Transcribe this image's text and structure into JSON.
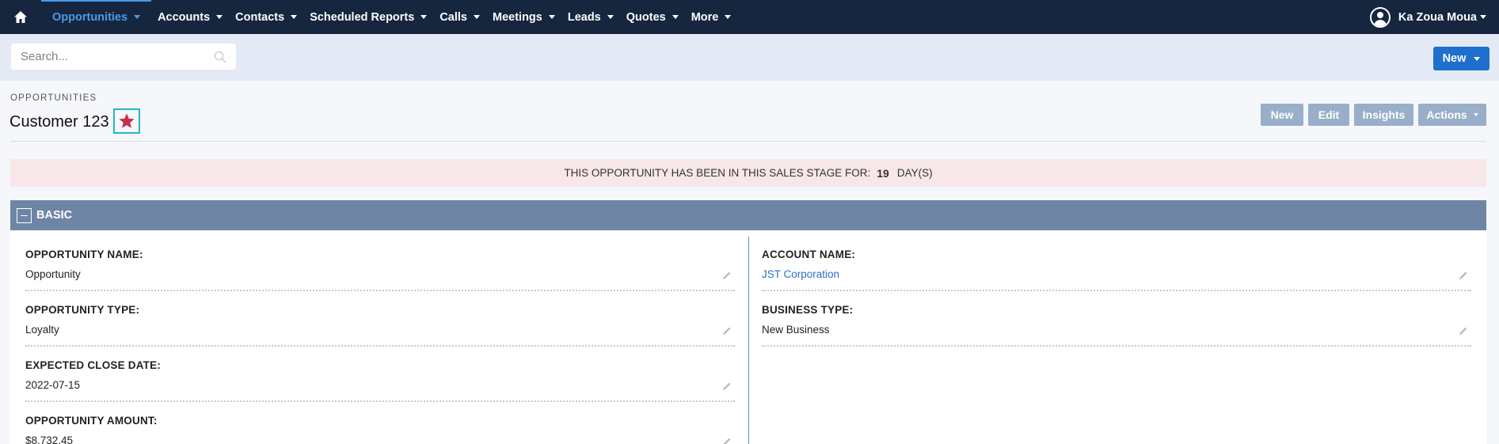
{
  "nav": {
    "items": [
      {
        "label": "Opportunities",
        "active": true
      },
      {
        "label": "Accounts"
      },
      {
        "label": "Contacts"
      },
      {
        "label": "Scheduled Reports"
      },
      {
        "label": "Calls"
      },
      {
        "label": "Meetings"
      },
      {
        "label": "Leads"
      },
      {
        "label": "Quotes"
      },
      {
        "label": "More"
      }
    ],
    "user": "Ka Zoua Moua"
  },
  "search": {
    "placeholder": "Search..."
  },
  "create": {
    "label": "New"
  },
  "header": {
    "module": "OPPORTUNITIES",
    "title": "Customer 123",
    "favorite": true,
    "buttons": {
      "new": "New",
      "edit": "Edit",
      "insights": "Insights",
      "actions": "Actions"
    }
  },
  "banner": {
    "prefix": "THIS OPPORTUNITY HAS BEEN IN THIS SALES STAGE FOR:",
    "days": "19",
    "suffix": "DAY(S)"
  },
  "panel": {
    "title": "BASIC",
    "left": [
      {
        "label": "OPPORTUNITY NAME:",
        "value": "Opportunity"
      },
      {
        "label": "OPPORTUNITY TYPE:",
        "value": "Loyalty"
      },
      {
        "label": "EXPECTED CLOSE DATE:",
        "value": "2022-07-15"
      },
      {
        "label": "OPPORTUNITY AMOUNT:",
        "value": "$8,732.45"
      }
    ],
    "right": [
      {
        "label": "ACCOUNT NAME:",
        "value": "JST Corporation",
        "link": true
      },
      {
        "label": "BUSINESS TYPE:",
        "value": "New Business"
      }
    ]
  },
  "colors": {
    "nav_bg": "#16263f",
    "accent": "#4a9ae8",
    "primary_button": "#1f6fce",
    "panel_header": "#6e85a5",
    "favorite_star": "#c3304a"
  }
}
